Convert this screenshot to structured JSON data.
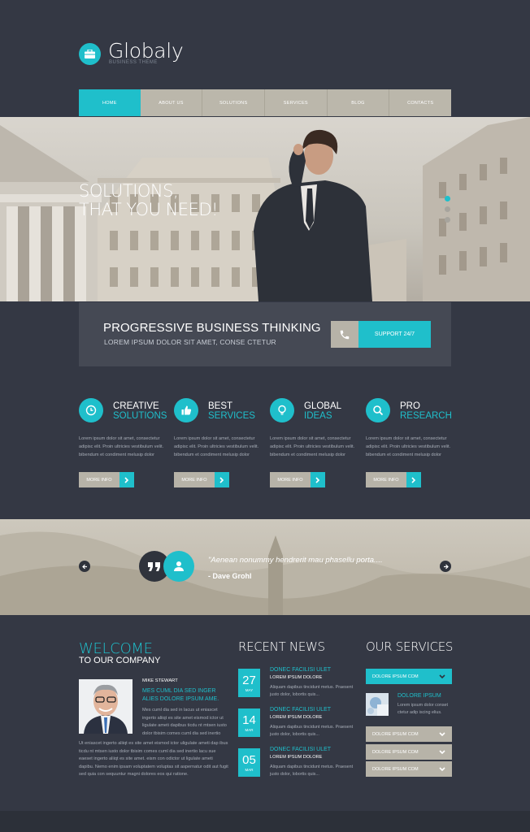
{
  "brand": {
    "name": "Globaly",
    "tagline": "BUSINESS THEME"
  },
  "nav": {
    "items": [
      "HOME",
      "ABOUT US",
      "SOLUTIONS",
      "SERVICES",
      "BLOG",
      "CONTACTS"
    ],
    "active": "HOME"
  },
  "hero": {
    "line1": "SOLUTIONS,",
    "line2": "THAT YOU NEED!",
    "slide_count": 3,
    "active_slide": 1
  },
  "banner": {
    "title": "PROGRESSIVE BUSINESS THINKING",
    "subtitle": "LOREM IPSUM DOLOR SIT AMET, CONSE CTETUR",
    "support_label": "SUPPORT 24/7"
  },
  "features": [
    {
      "icon": "clock-icon",
      "title1": "CREATIVE",
      "title2": "SOLUTIONS",
      "body": "Lorem ipsum dolor sit amet, consectetur adipisc elit. Proin ultricies vestibulum velit. bibendum et condiment melusip dolor",
      "button": "MORE INFO"
    },
    {
      "icon": "thumbs-up-icon",
      "title1": "BEST",
      "title2": "SERVICES",
      "body": "Lorem ipsum dolor sit amet, consectetur adipisc elit. Proin ultricies vestibulum velit. bibendum et condiment melusip dolor",
      "button": "MORE INFO"
    },
    {
      "icon": "lightbulb-icon",
      "title1": "GLOBAL",
      "title2": "IDEAS",
      "body": "Lorem ipsum dolor sit amet, consectetur adipisc elit. Proin ultricies vestibulum velit. bibendum et condiment melusip dolor",
      "button": "MORE INFO"
    },
    {
      "icon": "search-icon",
      "title1": "PRO",
      "title2": "RESEARCH",
      "body": "Lorem ipsum dolor sit amet, consectetur adipisc elit. Proin ultricies vestibulum velit. bibendum et condiment melusip dolor",
      "button": "MORE INFO"
    }
  ],
  "testimonial": {
    "quote": "\"Aenean nonummy hendrerit mau phasellu porta....",
    "author": "- Dave Grohl"
  },
  "welcome": {
    "title": "WELCOME",
    "subtitle": "TO OUR COMPANY",
    "person_name": "MIKE STEWART",
    "person_title": "MES CUML DIA SED INGER ALIES DOLORE IPSUM AME.",
    "person_body": "Mes cuml dia sed in lacus ut eniascet ingerto aliiqt es site amet eismod ictor ut ligulate ameti dapibus ticdu nt mtsen iusto dolor tbisim comes cuml dia sed inertio",
    "body": "Ut eniascet ingerto aliiqt es site amet eismod ictor uligulate ameti dap ibus ticdu nt mtsen iusto dolor tbisim comes cuml dia sed inertio lacu sue eaeset ingerto aliiqt es site amet. eism con odictor ut ligulate ameti dapibu. Nemo enim ipsam voluptatem voluptas sit aspernatur odit aut fugit sed quia con sequuntur magni dolores eos qui ratione."
  },
  "news": {
    "title": "RECENT NEWS",
    "items": [
      {
        "day": "27",
        "month": "MAY",
        "title": "DONEC FACILISI ULET",
        "subtitle": "LOREM IPSUM DOLORE",
        "body": "Aliquam dapibus tincidunt metus. Praesent justo dolor, lobortis quis..."
      },
      {
        "day": "14",
        "month": "MAR",
        "title": "DONEC FACILISI ULET",
        "subtitle": "LOREM IPSUM DOLORE",
        "body": "Aliquam dapibus tincidunt metus. Praesent justo dolor, lobortis quis..."
      },
      {
        "day": "05",
        "month": "MAR",
        "title": "DONEC FACILISI ULET",
        "subtitle": "LOREM IPSUM DOLORE",
        "body": "Aliquam dapibus tincidunt metus. Praesent justo dolor, lobortis quis..."
      }
    ]
  },
  "services": {
    "title": "OUR SERVICES",
    "open_item": {
      "label": "DOLORE IPSUM COM",
      "heading": "DOLORE IPSUM",
      "body": "Lorem ipsum dolor conset ctetur adip iscing elius."
    },
    "collapsed": [
      "DOLORE IPSUM COM",
      "DOLORE IPSUM COM",
      "DOLORE IPSUM COM"
    ]
  },
  "colors": {
    "accent": "#1fbfcb",
    "background": "#343844",
    "neutral": "#b7b3a8"
  }
}
